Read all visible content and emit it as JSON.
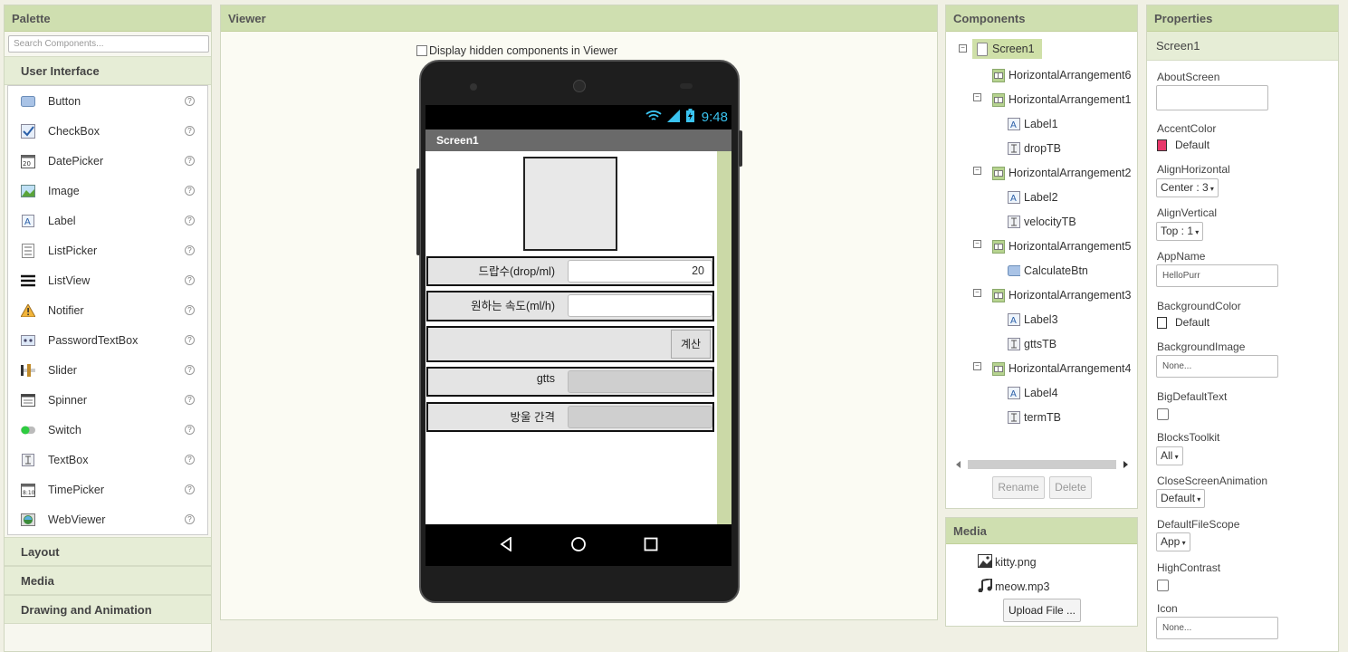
{
  "palette": {
    "title": "Palette",
    "search_placeholder": "Search Components...",
    "category_open": "User Interface",
    "items": [
      {
        "label": "Button",
        "icon": "button-icon"
      },
      {
        "label": "CheckBox",
        "icon": "checkbox-icon"
      },
      {
        "label": "DatePicker",
        "icon": "datepicker-icon"
      },
      {
        "label": "Image",
        "icon": "image-icon"
      },
      {
        "label": "Label",
        "icon": "label-icon"
      },
      {
        "label": "ListPicker",
        "icon": "listpicker-icon"
      },
      {
        "label": "ListView",
        "icon": "listview-icon"
      },
      {
        "label": "Notifier",
        "icon": "notifier-icon"
      },
      {
        "label": "PasswordTextBox",
        "icon": "password-icon"
      },
      {
        "label": "Slider",
        "icon": "slider-icon"
      },
      {
        "label": "Spinner",
        "icon": "spinner-icon"
      },
      {
        "label": "Switch",
        "icon": "switch-icon"
      },
      {
        "label": "TextBox",
        "icon": "textbox-icon"
      },
      {
        "label": "TimePicker",
        "icon": "timepicker-icon"
      },
      {
        "label": "WebViewer",
        "icon": "webviewer-icon"
      }
    ],
    "help_glyph": "?",
    "categories_closed": [
      "Layout",
      "Media",
      "Drawing and Animation"
    ]
  },
  "viewer": {
    "title": "Viewer",
    "hidden_checkbox_label": "Display hidden components in Viewer",
    "phone": {
      "time": "9:48",
      "screen_title": "Screen1",
      "rows": [
        {
          "label": "드랍수(drop/ml)",
          "value": "20"
        },
        {
          "label": "원하는 속도(ml/h)",
          "value": ""
        },
        {
          "button": "계산"
        },
        {
          "label": "gtts",
          "value": ""
        },
        {
          "label": "방울 간격",
          "value": ""
        }
      ]
    }
  },
  "components": {
    "title": "Components",
    "tree": [
      "Screen1",
      "HorizontalArrangement6",
      "HorizontalArrangement1",
      "Label1",
      "dropTB",
      "HorizontalArrangement2",
      "Label2",
      "velocityTB",
      "HorizontalArrangement5",
      "CalculateBtn",
      "HorizontalArrangement3",
      "Label3",
      "gttsTB",
      "HorizontalArrangement4",
      "Label4",
      "termTB"
    ],
    "rename": "Rename",
    "delete": "Delete"
  },
  "media": {
    "title": "Media",
    "files": [
      "kitty.png",
      "meow.mp3"
    ],
    "upload": "Upload File ..."
  },
  "properties": {
    "title": "Properties",
    "component": "Screen1",
    "about_label": "AboutScreen",
    "accent_label": "AccentColor",
    "accent_value": "Default",
    "accent_color": "#e8386b",
    "align_h_label": "AlignHorizontal",
    "align_h_value": "Center : 3",
    "align_v_label": "AlignVertical",
    "align_v_value": "Top : 1",
    "appname_label": "AppName",
    "appname_value": "HelloPurr",
    "bgcolor_label": "BackgroundColor",
    "bgcolor_value": "Default",
    "bgimage_label": "BackgroundImage",
    "bgimage_value": "None...",
    "bigtext_label": "BigDefaultText",
    "blocks_label": "BlocksToolkit",
    "blocks_value": "All",
    "close_anim_label": "CloseScreenAnimation",
    "close_anim_value": "Default",
    "filescope_label": "DefaultFileScope",
    "filescope_value": "App",
    "contrast_label": "HighContrast",
    "icon_label": "Icon",
    "icon_value": "None..."
  }
}
